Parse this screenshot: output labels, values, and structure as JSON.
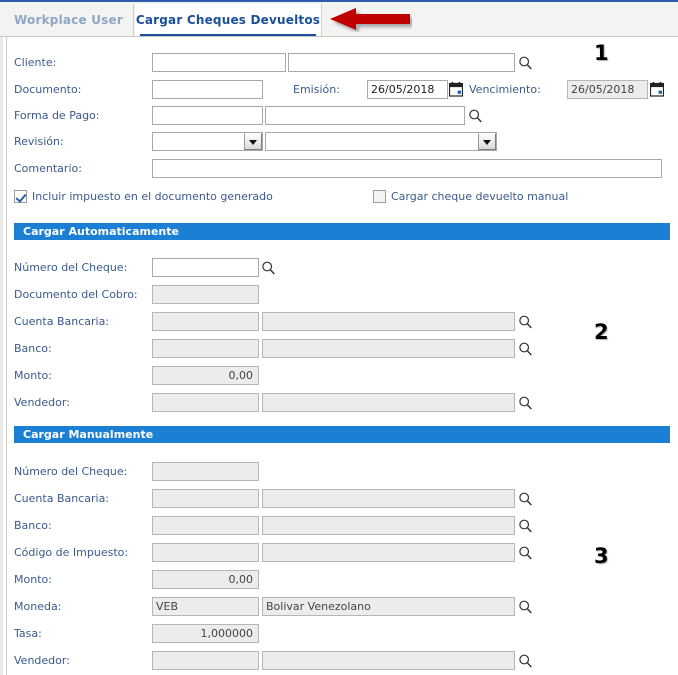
{
  "tabs": [
    {
      "label": "Workplace User",
      "active": false
    },
    {
      "label": "Cargar Cheques Devueltos",
      "active": true
    }
  ],
  "annotations": [
    {
      "text": "1"
    },
    {
      "text": "2"
    },
    {
      "text": "3"
    },
    {
      "icon": "left-arrow-annotation",
      "color": "#c00000"
    }
  ],
  "header_form": {
    "cliente": {
      "label": "Cliente:",
      "code_value": "",
      "name_value": "",
      "search_icon": "search-icon"
    },
    "documento": {
      "label": "Documento:",
      "value": ""
    },
    "emision": {
      "label": "Emisión:",
      "value": "26/05/2018",
      "calendar_icon": "calendar-icon"
    },
    "vencimiento": {
      "label": "Vencimiento:",
      "value": "26/05/2018",
      "calendar_icon": "calendar-icon"
    },
    "forma_de_pago": {
      "label": "Forma de Pago:",
      "code_value": "",
      "name_value": "",
      "search_icon": "search-icon"
    },
    "revision": {
      "label": "Revisión:",
      "value_left": "",
      "value_right": "",
      "dropdown_icon": "chevron-down-icon"
    },
    "comentario": {
      "label": "Comentario:",
      "value": ""
    },
    "incluir_impuesto": {
      "label": "Incluir impuesto en el documento generado",
      "checked": true
    },
    "cargar_manual": {
      "label": "Cargar cheque devuelto manual",
      "checked": false
    }
  },
  "section_auto": {
    "title": "Cargar Automaticamente",
    "fields": [
      {
        "label": "Número del Cheque:",
        "code_value": "",
        "name_value": null,
        "disabled": false,
        "search_icon": "search-icon"
      },
      {
        "label": "Documento del Cobro:",
        "code_value": "",
        "name_value": null,
        "disabled": true,
        "search_icon": null
      },
      {
        "label": "Cuenta Bancaria:",
        "code_value": "",
        "name_value": "",
        "disabled": true,
        "search_icon": "search-icon"
      },
      {
        "label": "Banco:",
        "code_value": "",
        "name_value": "",
        "disabled": true,
        "search_icon": "search-icon"
      },
      {
        "label": "Monto:",
        "code_value": "0,00",
        "name_value": null,
        "disabled": true,
        "search_icon": null,
        "numeric": true
      },
      {
        "label": "Vendedor:",
        "code_value": "",
        "name_value": "",
        "disabled": true,
        "search_icon": "search-icon"
      }
    ]
  },
  "section_manual": {
    "title": "Cargar Manualmente",
    "fields": [
      {
        "label": "Número del Cheque:",
        "code_value": "",
        "name_value": null,
        "disabled": true,
        "search_icon": null
      },
      {
        "label": "Cuenta Bancaria:",
        "code_value": "",
        "name_value": "",
        "disabled": true,
        "search_icon": "search-icon"
      },
      {
        "label": "Banco:",
        "code_value": "",
        "name_value": "",
        "disabled": true,
        "search_icon": "search-icon"
      },
      {
        "label": "Código de Impuesto:",
        "code_value": "",
        "name_value": "",
        "disabled": true,
        "search_icon": "search-icon"
      },
      {
        "label": "Monto:",
        "code_value": "0,00",
        "name_value": null,
        "disabled": true,
        "search_icon": null,
        "numeric": true
      },
      {
        "label": "Moneda:",
        "code_value": "VEB",
        "name_value": "Bolivar Venezolano",
        "disabled": true,
        "search_icon": "search-icon"
      },
      {
        "label": "Tasa:",
        "code_value": "1,000000",
        "name_value": null,
        "disabled": true,
        "search_icon": null,
        "numeric": true
      },
      {
        "label": "Vendedor:",
        "code_value": "",
        "name_value": "",
        "disabled": true,
        "search_icon": "search-icon"
      }
    ]
  },
  "colors": {
    "accent": "#1b7fd4",
    "tab_active_text": "#1b4f9c",
    "tab_inactive_text": "#8fa7c6",
    "label_text": "#3a5a8c",
    "arrow": "#c00000"
  }
}
